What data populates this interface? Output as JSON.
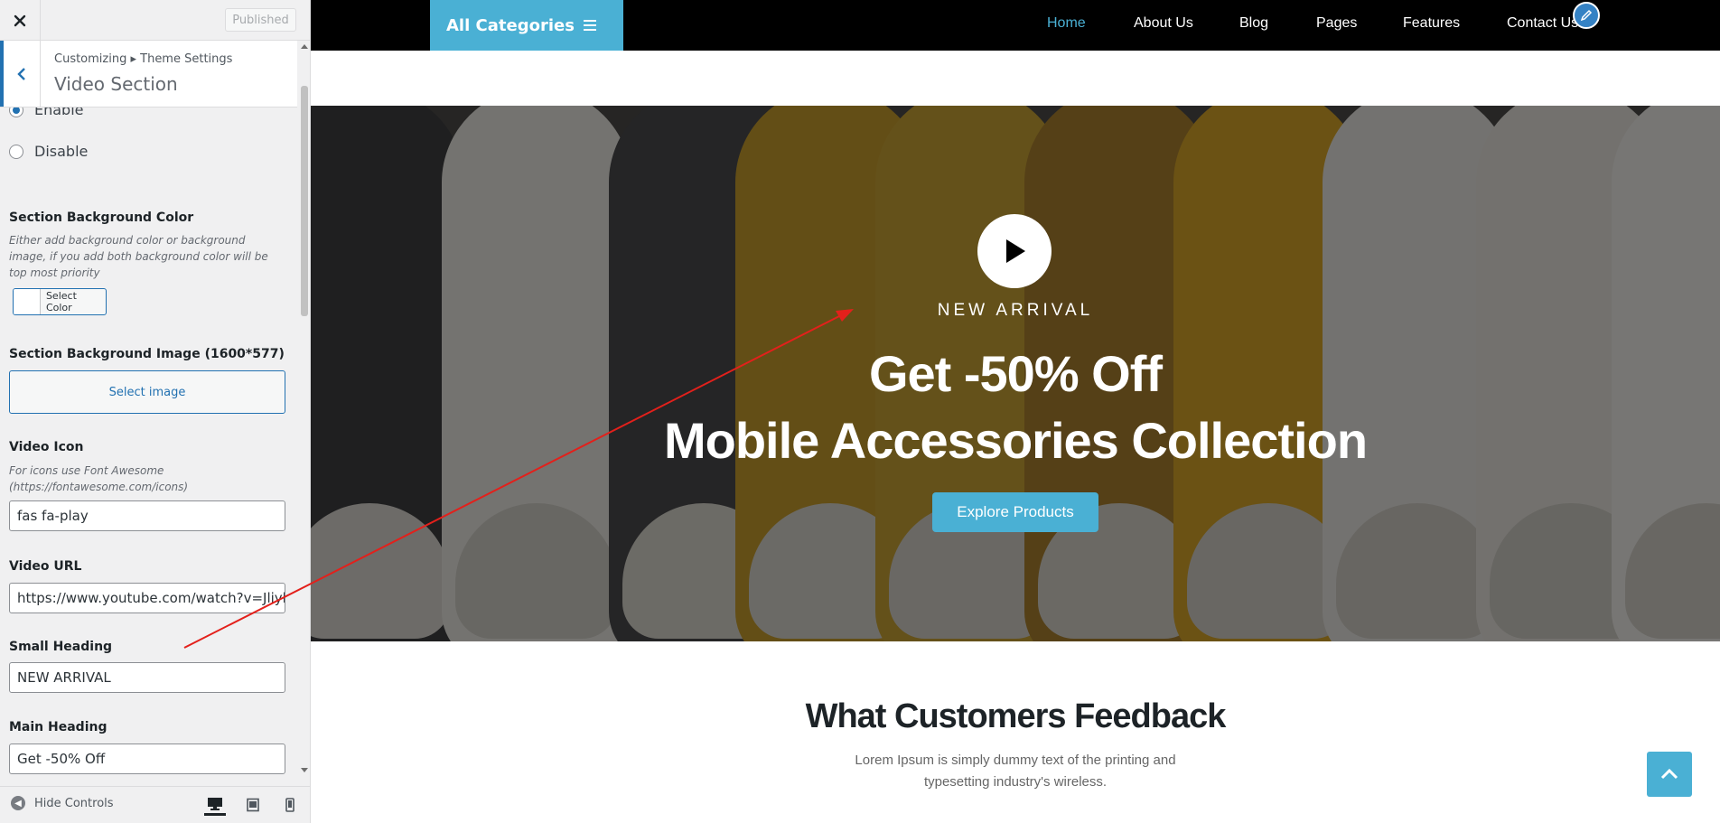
{
  "customizer": {
    "close_icon": "close-icon",
    "published_label": "Published",
    "breadcrumb": "Customizing ▸ Theme Settings",
    "section_title": "Video Section",
    "enable_label": "Enable",
    "disable_label": "Disable",
    "bg_color_label": "Section Background Color",
    "bg_color_desc": "Either add background color or background image, if you add both background color will be top most priority",
    "select_color_label": "Select Color",
    "bg_image_label": "Section Background Image (1600*577)",
    "select_image_label": "Select image",
    "video_icon_label": "Video Icon",
    "video_icon_desc": "For icons use Font Awesome (https://fontawesome.com/icons)",
    "video_icon_value": "fas fa-play",
    "video_url_label": "Video URL",
    "video_url_value": "https://www.youtube.com/watch?v=Jliyl",
    "small_heading_label": "Small Heading",
    "small_heading_value": "NEW ARRIVAL",
    "main_heading_label": "Main Heading",
    "main_heading_value": "Get -50% Off",
    "hide_controls_label": "Hide Controls"
  },
  "site": {
    "all_categories": "All Categories",
    "nav": [
      "Home",
      "About Us",
      "Blog",
      "Pages",
      "Features",
      "Contact Us"
    ],
    "hero": {
      "small_heading": "NEW ARRIVAL",
      "heading_line1": "Get -50% Off",
      "heading_line2": "Mobile Accessories Collection",
      "button_label": "Explore Products"
    },
    "feedback": {
      "title": "What Customers Feedback",
      "desc": "Lorem Ipsum is simply dummy text of the printing and typesetting industry's wireless."
    }
  },
  "colors": {
    "accent": "#4ab0d4",
    "wp_blue": "#2271b1",
    "annotation_arrow": "#e3201b"
  }
}
